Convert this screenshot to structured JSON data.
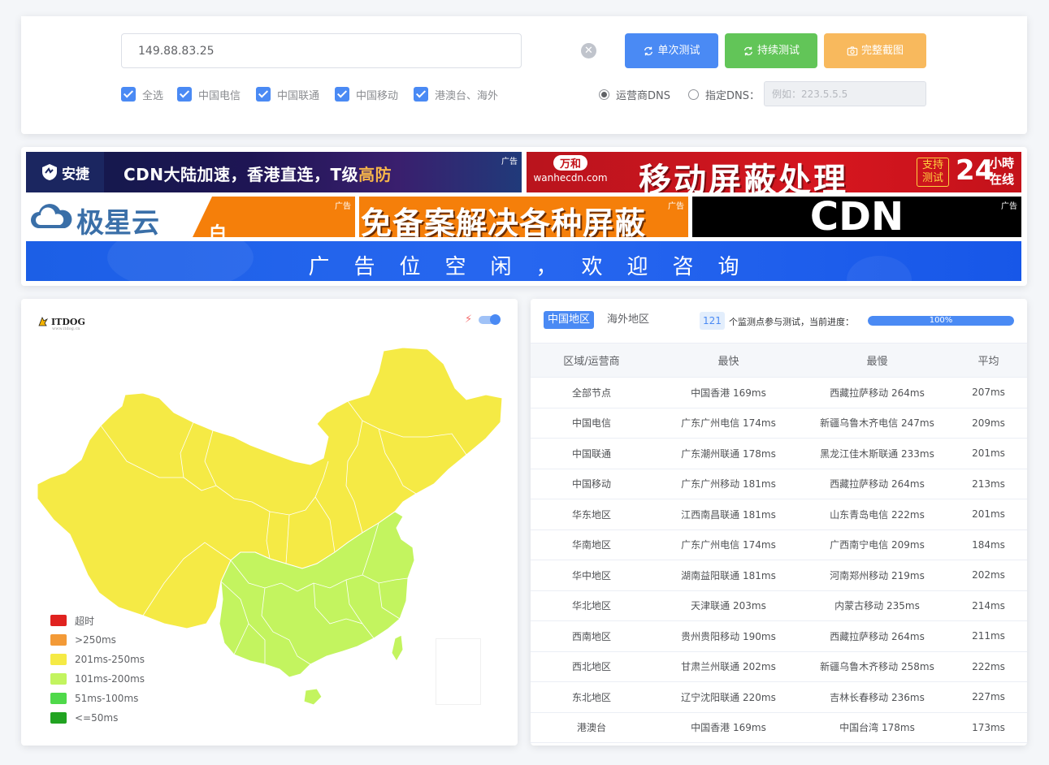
{
  "search": {
    "ip_value": "149.88.83.25",
    "buttons": {
      "single": "单次测试",
      "continuous": "持续测试",
      "screenshot": "完整截图"
    }
  },
  "filters": {
    "isps": [
      {
        "label": "全选",
        "checked": true
      },
      {
        "label": "中国电信",
        "checked": true
      },
      {
        "label": "中国联通",
        "checked": true
      },
      {
        "label": "中国移动",
        "checked": true
      },
      {
        "label": "港澳台、海外",
        "checked": true
      }
    ],
    "dns": {
      "isp_dns": "运营商DNS",
      "custom_dns": "指定DNS：",
      "custom_placeholder": "例如：223.5.5.5",
      "selected": "isp_dns"
    }
  },
  "ads": {
    "tag": "广告",
    "anjie": {
      "brand": "安捷",
      "text_main": "CDN大陆加速，香港直连，T级",
      "text_highlight": "高防"
    },
    "wanhe": {
      "brand": "万和",
      "domain": "wanhecdn.com",
      "headline": "移动屏蔽处理",
      "support": "支持测试",
      "hours": "24",
      "hours_suffix1": "小時",
      "hours_suffix2": "在线"
    },
    "jixing": {
      "brand": "极星云",
      "partial": "白"
    },
    "mianbei": {
      "headline": "免备案解决各种屏蔽"
    },
    "cdn": {
      "headline": "CDN"
    },
    "free": {
      "text": "广告位空闲，欢迎咨询"
    }
  },
  "map": {
    "logo": "ITDOG",
    "logo_sub": "www.itdog.cn",
    "legend": [
      {
        "label": "超时",
        "color": "#e0221f"
      },
      {
        "label": ">250ms",
        "color": "#f39a37"
      },
      {
        "label": "201ms-250ms",
        "color": "#f5ea45"
      },
      {
        "label": "101ms-200ms",
        "color": "#c3f45f"
      },
      {
        "label": "51ms-100ms",
        "color": "#4fd94a"
      },
      {
        "label": "<=50ms",
        "color": "#21a321"
      }
    ],
    "colors": {
      "north_west": "#f5ea45",
      "south_east": "#c3f45f"
    }
  },
  "results": {
    "tabs": {
      "china": "中国地区",
      "overseas": "海外地区"
    },
    "node_count": "121",
    "progress_label": "个监测点参与测试，当前进度：",
    "progress_value": "100%",
    "progress_fraction": 1.0,
    "headers": {
      "region": "区域/运营商",
      "fastest": "最快",
      "slowest": "最慢",
      "average": "平均"
    },
    "rows": [
      {
        "region": "全部节点",
        "fastest": "中国香港 169ms",
        "slowest": "西藏拉萨移动 264ms",
        "average": "207ms"
      },
      {
        "region": "中国电信",
        "fastest": "广东广州电信 174ms",
        "slowest": "新疆乌鲁木齐电信 247ms",
        "average": "209ms"
      },
      {
        "region": "中国联通",
        "fastest": "广东潮州联通 178ms",
        "slowest": "黑龙江佳木斯联通 233ms",
        "average": "201ms"
      },
      {
        "region": "中国移动",
        "fastest": "广东广州移动 181ms",
        "slowest": "西藏拉萨移动 264ms",
        "average": "213ms"
      },
      {
        "region": "华东地区",
        "fastest": "江西南昌联通 181ms",
        "slowest": "山东青岛电信 222ms",
        "average": "201ms"
      },
      {
        "region": "华南地区",
        "fastest": "广东广州电信 174ms",
        "slowest": "广西南宁电信 209ms",
        "average": "184ms"
      },
      {
        "region": "华中地区",
        "fastest": "湖南益阳联通 181ms",
        "slowest": "河南郑州移动 219ms",
        "average": "202ms"
      },
      {
        "region": "华北地区",
        "fastest": "天津联通 203ms",
        "slowest": "内蒙古移动 235ms",
        "average": "214ms"
      },
      {
        "region": "西南地区",
        "fastest": "贵州贵阳移动 190ms",
        "slowest": "西藏拉萨移动 264ms",
        "average": "211ms"
      },
      {
        "region": "西北地区",
        "fastest": "甘肃兰州联通 202ms",
        "slowest": "新疆乌鲁木齐移动 258ms",
        "average": "222ms"
      },
      {
        "region": "东北地区",
        "fastest": "辽宁沈阳联通 220ms",
        "slowest": "吉林长春移动 236ms",
        "average": "227ms"
      },
      {
        "region": "港澳台",
        "fastest": "中国香港 169ms",
        "slowest": "中国台湾 178ms",
        "average": "173ms"
      }
    ]
  }
}
